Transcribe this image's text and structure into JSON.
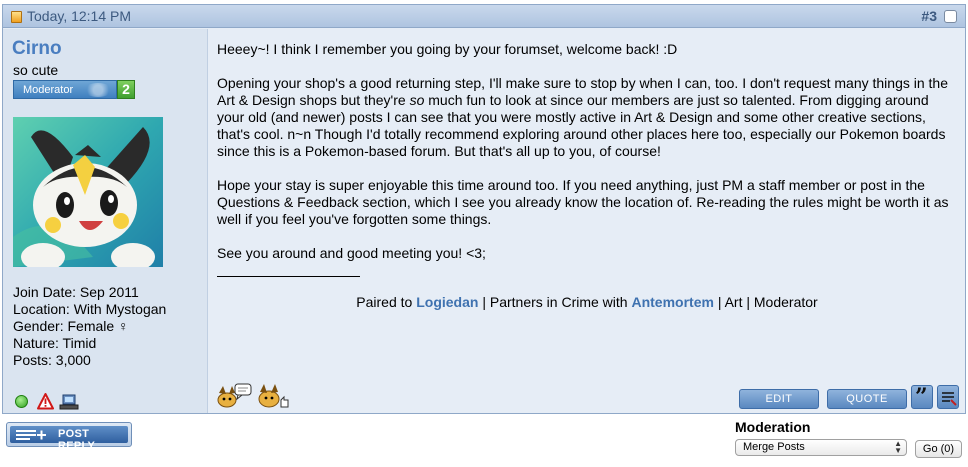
{
  "post": {
    "date": "Today, 12:14 PM",
    "number": "#3"
  },
  "user": {
    "name": "Cirno",
    "title": "so cute",
    "rank_label": "Moderator",
    "rank_count": "2",
    "stats": [
      "Join Date: Sep 2011",
      "Location: With Mystogan",
      "Gender: Female ♀",
      "Nature: Timid",
      "Posts: 3,000"
    ]
  },
  "message": {
    "p1": "Heeey~! I think I remember you going by your forumset, welcome back! :D",
    "p2_before": "Opening your shop's a good returning step, I'll make sure to stop by when I can, too. I don't request many things in the Art & Design shops but they're ",
    "p2_em": "so",
    "p2_after": " much fun to look at since our members are just so talented. From digging around your old (and newer) posts I can see that you were mostly active in Art & Design and some other creative sections, that's cool. n~n Though I'd totally recommend exploring around other places here too, especially our Pokemon boards since this is a Pokemon-based forum. But that's all up to you, of course!",
    "p3": "Hope your stay is super enjoyable this time around too. If you need anything, just PM a staff member or post in the Questions & Feedback section, which I see you already know the location of. Re-reading the rules might be worth it as well if you feel you've forgotten some things.",
    "p4": "See you around and good meeting you! <3;"
  },
  "signature": {
    "paired_to": "Paired to ",
    "partner1": "Logiedan",
    "partners_in_crime": " | Partners in Crime with ",
    "partner2": "Antemortem",
    "tail": " | Art | Moderator"
  },
  "buttons": {
    "edit": "EDIT",
    "quote": "QUOTE",
    "multiquote_glyph": "”",
    "post_reply": "POST REPLY"
  },
  "moderation": {
    "title": "Moderation",
    "selected": "Merge Posts",
    "go": "Go (0)"
  },
  "icons": {
    "post": "document-icon",
    "online": "online-status-icon",
    "report": "report-warning-icon",
    "ip": "ip-computer-icon",
    "emote1": "pokemon-speech-emote",
    "emote2": "pokemon-reputation-emote"
  },
  "colors": {
    "header_bg": "#aec4e0",
    "username": "#4a7ec0",
    "link": "#3f72b0",
    "button": "#5a88c0",
    "rank_green": "#3f9f2f"
  }
}
